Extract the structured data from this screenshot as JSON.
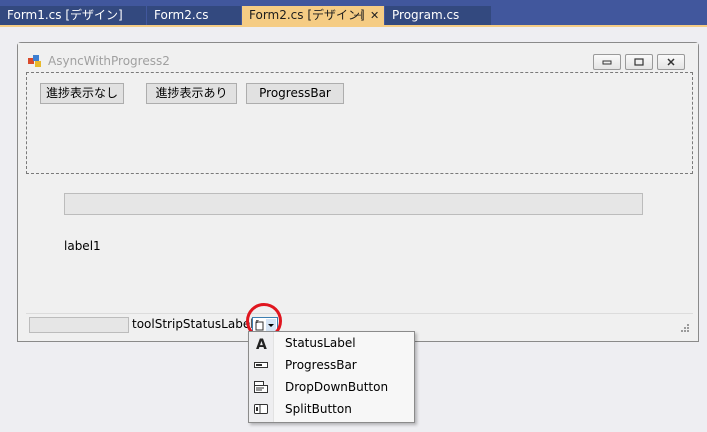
{
  "tabs": [
    {
      "label": "Form1.cs [デザイン]",
      "active": false
    },
    {
      "label": "Form2.cs",
      "active": false
    },
    {
      "label": "Form2.cs [デザイン]",
      "active": true
    },
    {
      "label": "Program.cs",
      "active": false
    }
  ],
  "form": {
    "title": "AsyncWithProgress2",
    "buttons": [
      "進捗表示なし",
      "進捗表示あり",
      "ProgressBar"
    ],
    "label": "label1",
    "status": {
      "label": "toolStripStatusLabel1"
    }
  },
  "menu": {
    "items": [
      {
        "label": "StatusLabel",
        "icon": "status-label-icon"
      },
      {
        "label": "ProgressBar",
        "icon": "progress-bar-icon"
      },
      {
        "label": "DropDownButton",
        "icon": "dropdown-button-icon"
      },
      {
        "label": "SplitButton",
        "icon": "split-button-icon"
      }
    ]
  },
  "colors": {
    "tab_strip": "#41579d",
    "active_tab": "#f5cc84",
    "highlight": "#e0161f"
  }
}
